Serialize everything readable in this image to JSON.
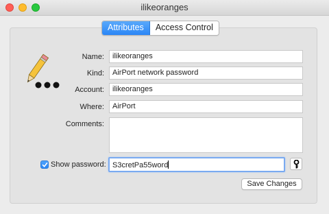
{
  "window": {
    "title": "ilikeoranges"
  },
  "tabs": [
    {
      "label": "Attributes",
      "active": true
    },
    {
      "label": "Access Control",
      "active": false
    }
  ],
  "form": {
    "name_label": "Name:",
    "name_value": "ilikeoranges",
    "kind_label": "Kind:",
    "kind_value": "AirPort network password",
    "account_label": "Account:",
    "account_value": "ilikeoranges",
    "where_label": "Where:",
    "where_value": "AirPort",
    "comments_label": "Comments:",
    "comments_value": "",
    "show_password_label": "Show password:",
    "show_password_checked": true,
    "password_value": "S3cretPa55word"
  },
  "buttons": {
    "save_label": "Save Changes"
  },
  "icons": {
    "item": "keychain-password-pencil-icon",
    "key": "key-icon"
  },
  "colors": {
    "accent": "#2a86f6",
    "close": "#ff5f57",
    "minimize": "#febc2e",
    "zoom": "#28c840"
  }
}
